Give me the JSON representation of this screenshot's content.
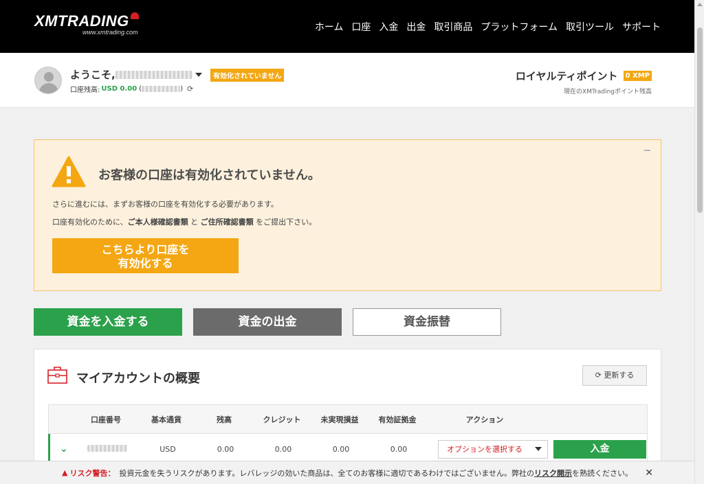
{
  "brand": {
    "logo_main": "XMTRADING",
    "logo_sub": "www.xmtrading.com"
  },
  "nav": {
    "items": [
      "ホーム",
      "口座",
      "入金",
      "出金",
      "取引商品",
      "プラットフォーム",
      "取引ツール",
      "サポート"
    ]
  },
  "user": {
    "welcome_prefix": "ようこそ,",
    "status_badge": "有効化されていません",
    "balance_label": "口座残高:",
    "balance_value": "USD 0.00",
    "balance_paren_open": "(",
    "balance_paren_close": ")"
  },
  "loyalty": {
    "title": "ロイヤルティポイント",
    "points": "0 XMP",
    "subtitle": "現在のXMTradingポイント残高"
  },
  "warning": {
    "title": "お客様の口座は有効化されていません。",
    "line1": "さらに進むには、まずお客様の口座を有効化する必要があります。",
    "line2_a": "口座有効化のために、",
    "line2_b": "ご本人様確認書類",
    "line2_c": " と ",
    "line2_d": "ご住所確認書類",
    "line2_e": " をご提出下さい。",
    "button_line1": "こちらより口座を",
    "button_line2": "有効化する",
    "colors": {
      "accent": "#f4a712",
      "background": "#fdf1dd"
    }
  },
  "actions": {
    "deposit": "資金を入金する",
    "withdraw": "資金の出金",
    "transfer": "資金振替"
  },
  "accounts": {
    "title": "マイアカウントの概要",
    "update_button": "更新する",
    "columns": [
      "口座番号",
      "基本通貨",
      "残高",
      "クレジット",
      "未実現損益",
      "有効証拠金",
      "アクション"
    ],
    "rows": [
      {
        "currency": "USD",
        "balance": "0.00",
        "credit": "0.00",
        "unrealized": "0.00",
        "equity": "0.00",
        "option_select": "オプションを選択する",
        "deposit_button": "入金"
      }
    ]
  },
  "risk": {
    "label": "リスク警告：",
    "text": "投資元金を失うリスクがあります。レバレッジの効いた商品は、全てのお客様に適切であるわけではございません。弊社の",
    "link": "リスク開示",
    "text_after": "を熟読ください。"
  },
  "colors": {
    "green": "#2aa14a",
    "orange": "#f4a712",
    "red": "#d51f26",
    "gray_button": "#6b6b6b"
  }
}
